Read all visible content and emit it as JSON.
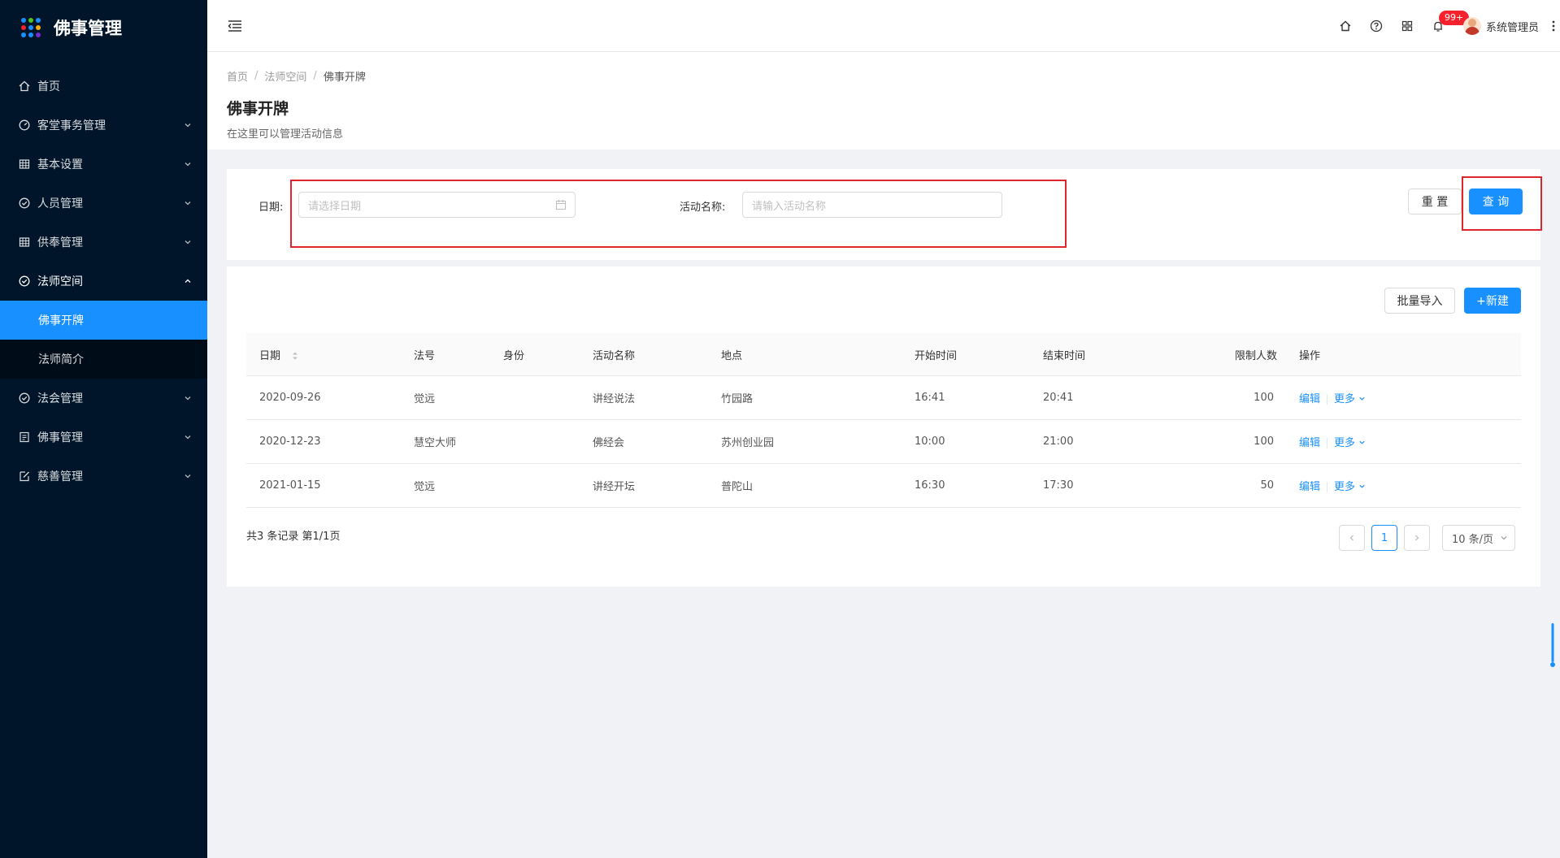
{
  "sidebar": {
    "logo_text": "佛事管理",
    "logo_dot_colors": [
      "#1890ff",
      "#52c41a",
      "#1890ff",
      "#f5222d",
      "#1890ff",
      "#faad14",
      "#1890ff",
      "#1890ff",
      "#722ed1"
    ],
    "items": [
      {
        "label": "首页",
        "icon": "home-icon"
      },
      {
        "label": "客堂事务管理",
        "icon": "dashboard-icon"
      },
      {
        "label": "基本设置",
        "icon": "table-icon"
      },
      {
        "label": "人员管理",
        "icon": "check-circle-icon"
      },
      {
        "label": "供奉管理",
        "icon": "table-icon"
      },
      {
        "label": "法师空间",
        "icon": "check-circle-icon"
      },
      {
        "label": "法会管理",
        "icon": "check-circle-icon"
      },
      {
        "label": "佛事管理",
        "icon": "profile-icon"
      },
      {
        "label": "慈善管理",
        "icon": "edit-icon"
      }
    ],
    "submenu": [
      {
        "label": "佛事开牌"
      },
      {
        "label": "法师简介"
      }
    ]
  },
  "header": {
    "badge": "99+",
    "username": "系统管理员"
  },
  "page": {
    "breadcrumb": [
      "首页",
      "法师空间",
      "佛事开牌"
    ],
    "title": "佛事开牌",
    "desc": "在这里可以管理活动信息"
  },
  "search": {
    "date_label": "日期:",
    "date_placeholder": "请选择日期",
    "name_label": "活动名称:",
    "name_placeholder": "请输入活动名称",
    "reset": "重 置",
    "query": "查 询"
  },
  "toolbar": {
    "import": "批量导入",
    "create": "+新建"
  },
  "table": {
    "columns": [
      "日期",
      "法号",
      "身份",
      "活动名称",
      "地点",
      "开始时间",
      "结束时间",
      "限制人数",
      "操作"
    ],
    "rows": [
      {
        "date": "2020-09-26",
        "name": "觉远",
        "role": "",
        "activity": "讲经说法",
        "place": "竹园路",
        "start": "16:41",
        "end": "20:41",
        "limit": "100"
      },
      {
        "date": "2020-12-23",
        "name": "慧空大师",
        "role": "",
        "activity": "佛经会",
        "place": "苏州创业园",
        "start": "10:00",
        "end": "21:00",
        "limit": "100"
      },
      {
        "date": "2021-01-15",
        "name": "觉远",
        "role": "",
        "activity": "讲经开坛",
        "place": "普陀山",
        "start": "16:30",
        "end": "17:30",
        "limit": "50"
      }
    ],
    "edit": "编辑",
    "more": "更多"
  },
  "pagination": {
    "total": "共3 条记录 第1/1页",
    "current": "1",
    "page_size": "10 条/页"
  },
  "colors": {
    "primary": "#1890ff",
    "sidebar": "#001529",
    "highlight": "#e0262d"
  }
}
